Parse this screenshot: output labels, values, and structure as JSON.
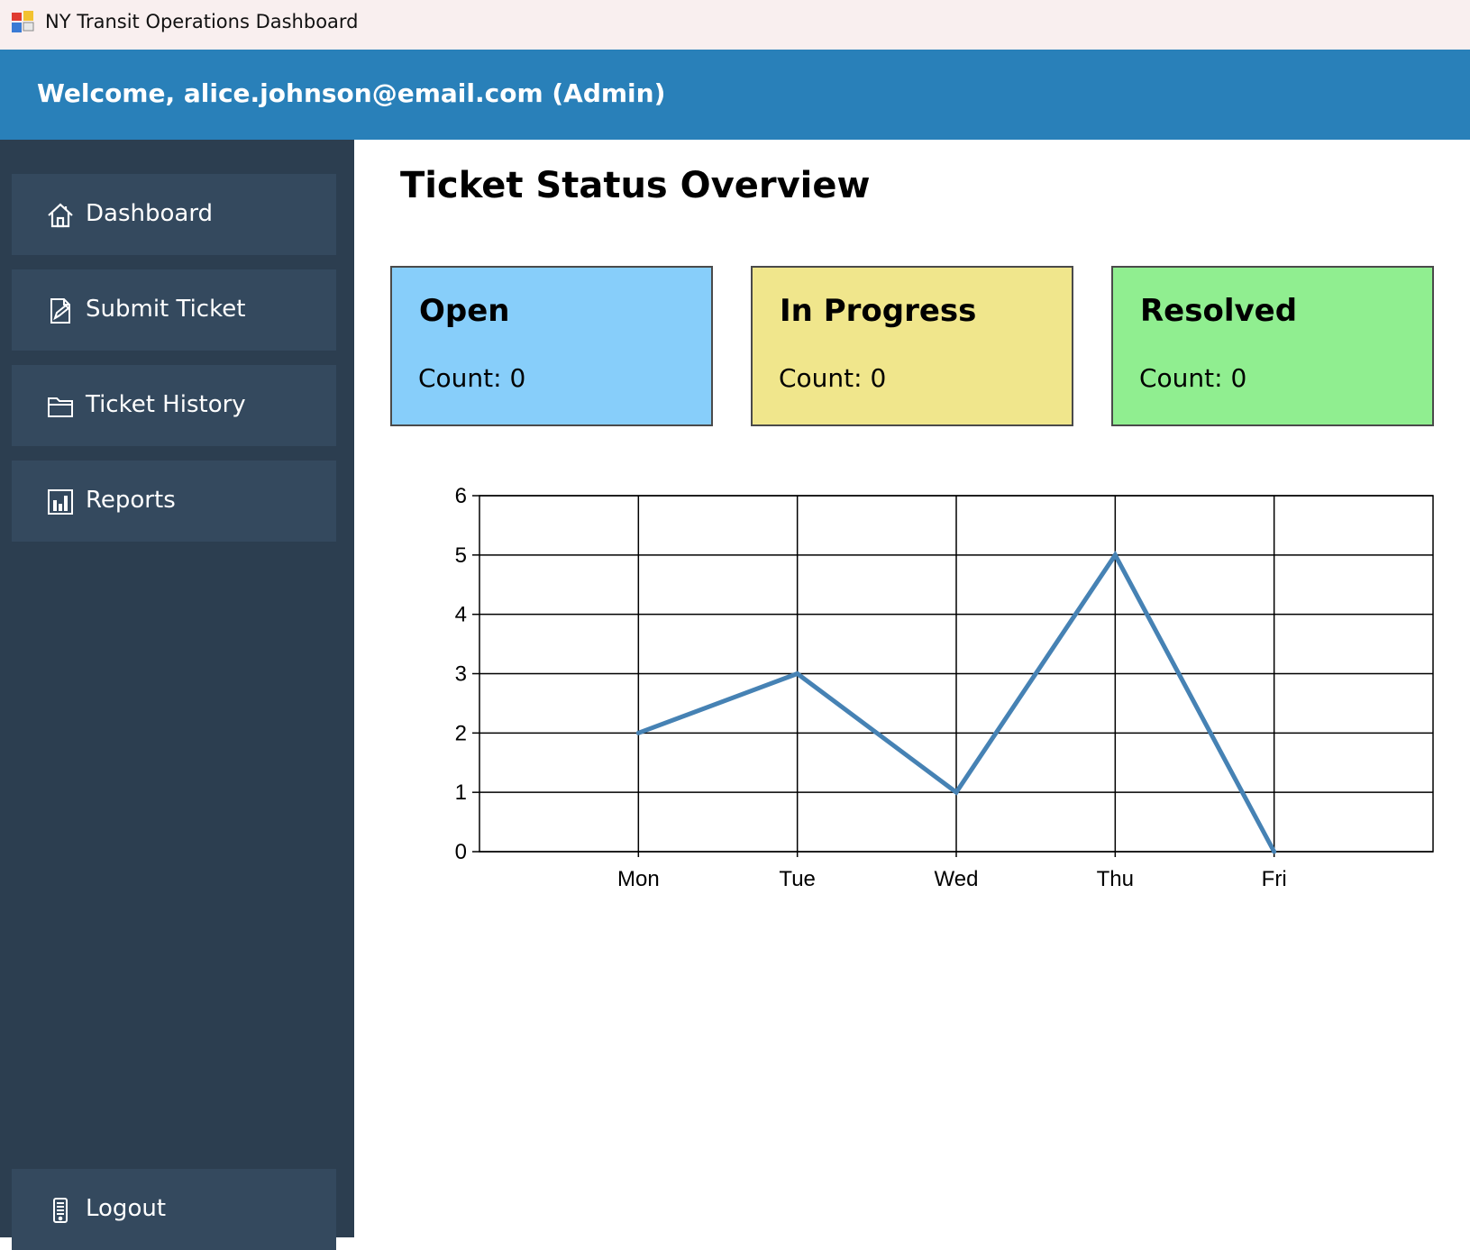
{
  "window": {
    "title": "NY Transit Operations Dashboard",
    "icon": "app-window-icon"
  },
  "header": {
    "welcome": "Welcome, alice.johnson@email.com (Admin)",
    "color": "#2980b9"
  },
  "sidebar": {
    "background": "#2c3e50",
    "item_background": "#34495e",
    "items": [
      {
        "label": "Dashboard",
        "icon": "home-icon"
      },
      {
        "label": "Submit Ticket",
        "icon": "edit-document-icon"
      },
      {
        "label": "Ticket History",
        "icon": "folder-icon"
      },
      {
        "label": "Reports",
        "icon": "bar-chart-icon"
      }
    ],
    "logout": {
      "label": "Logout",
      "icon": "logout-icon"
    }
  },
  "main": {
    "title": "Ticket Status Overview",
    "cards": [
      {
        "title": "Open",
        "count": "Count: 0",
        "color": "#87cefa"
      },
      {
        "title": "In Progress",
        "count": "Count: 0",
        "color": "#f0e68c"
      },
      {
        "title": "Resolved",
        "count": "Count: 0",
        "color": "#90ee90"
      }
    ]
  },
  "chart_data": {
    "type": "line",
    "categories": [
      "Mon",
      "Tue",
      "Wed",
      "Thu",
      "Fri"
    ],
    "values": [
      2,
      3,
      1,
      5,
      0
    ],
    "title": "",
    "xlabel": "",
    "ylabel": "",
    "ylim": [
      0,
      6
    ],
    "grid": true,
    "line_color": "#4682b4"
  }
}
